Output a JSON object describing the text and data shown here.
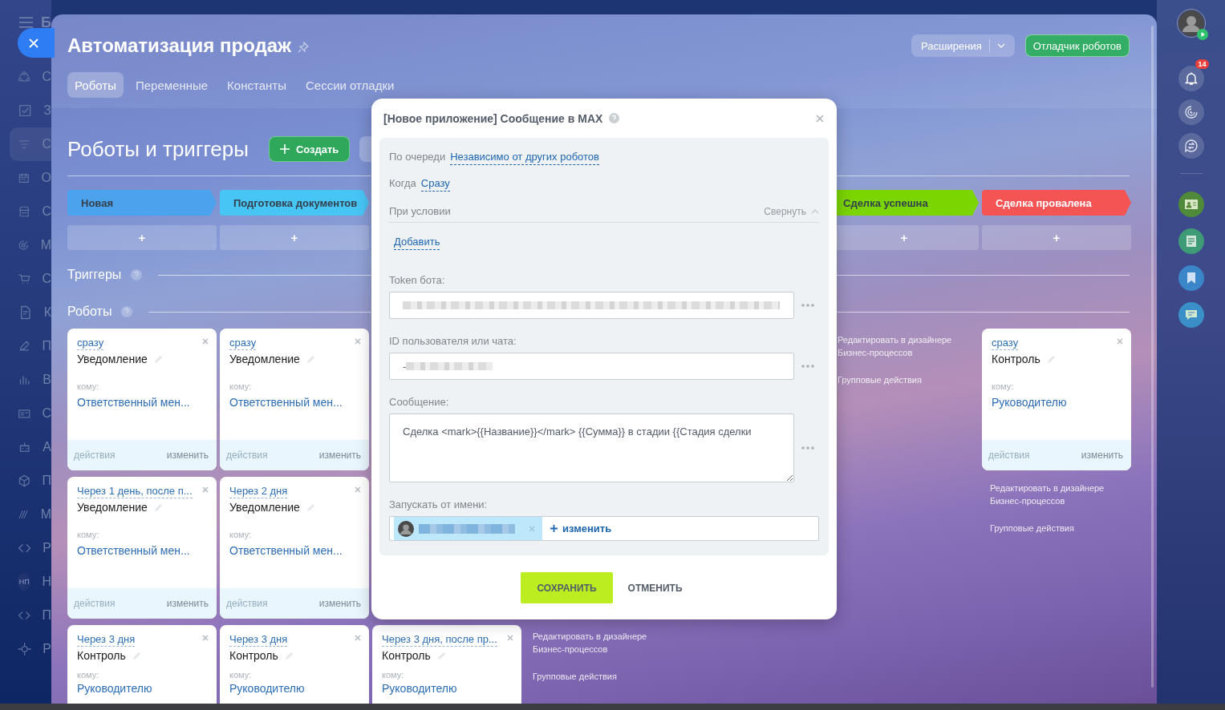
{
  "sidebar": {
    "header_letter": "Б",
    "items": [
      {
        "kind": "link",
        "label": "С",
        "selected": false
      },
      {
        "kind": "link",
        "label": "З",
        "selected": false
      },
      {
        "kind": "link",
        "label": "С",
        "selected": true
      },
      {
        "kind": "link",
        "label": "О",
        "selected": false
      },
      {
        "kind": "link",
        "label": "С",
        "selected": false
      },
      {
        "kind": "link",
        "label": "М",
        "selected": false
      },
      {
        "kind": "link",
        "label": "С",
        "selected": false
      },
      {
        "kind": "link",
        "label": "К",
        "selected": false
      },
      {
        "kind": "link",
        "label": "П",
        "selected": false
      },
      {
        "kind": "link",
        "label": "В",
        "selected": false
      },
      {
        "kind": "link",
        "label": "С",
        "selected": false
      },
      {
        "kind": "link",
        "label": "А",
        "selected": false
      },
      {
        "kind": "link",
        "label": "П",
        "selected": false
      },
      {
        "kind": "link",
        "label": "М",
        "selected": false
      },
      {
        "kind": "link",
        "label": "Р",
        "selected": false
      },
      {
        "kind": "avatar",
        "initials": "НП",
        "label": "Н",
        "selected": false
      },
      {
        "kind": "link",
        "label": "П",
        "selected": false
      },
      {
        "kind": "link",
        "label": "Р",
        "selected": false
      }
    ]
  },
  "panel": {
    "title": "Автоматизация продаж",
    "tabs": [
      {
        "label": "Роботы",
        "selected": true
      },
      {
        "label": "Переменные",
        "selected": false
      },
      {
        "label": "Константы",
        "selected": false
      },
      {
        "label": "Сессии отладки",
        "selected": false
      }
    ],
    "extensions_button": "Расширения",
    "debugger_button": "Отладчик роботов"
  },
  "section": {
    "title": "Роботы и триггеры",
    "create_button": "Создать",
    "triggers_heading": "Триггеры",
    "robots_heading": "Роботы"
  },
  "columns": [
    {
      "stage": {
        "label": "Новая",
        "color": "#4ba3ee"
      },
      "add_label": "+",
      "robots": [
        {
          "delay": "сразу",
          "title": "Уведомление",
          "to_label": "кому:",
          "recipient": "Ответственный мен...",
          "actions": "действия",
          "edit": "изменить"
        },
        {
          "delay": "Через 1 день, после п...",
          "title": "Уведомление",
          "to_label": "кому:",
          "recipient": "Ответственный мен...",
          "actions": "действия",
          "edit": "изменить"
        },
        {
          "delay": "Через 3 дня",
          "title": "Контроль",
          "to_label": "кому:",
          "recipient": "Руководителю"
        }
      ]
    },
    {
      "stage": {
        "label": "Подготовка документов",
        "color": "#47c5f5"
      },
      "add_label": "+",
      "robots": [
        {
          "delay": "сразу",
          "title": "Уведомление",
          "to_label": "кому:",
          "recipient": "Ответственный мен...",
          "actions": "действия",
          "edit": "изменить"
        },
        {
          "delay": "Через 2 дня",
          "title": "Уведомление",
          "to_label": "кому:",
          "recipient": "Ответственный мен...",
          "actions": "действия",
          "edit": "изменить"
        },
        {
          "delay": "Через 3 дня",
          "title": "Контроль",
          "to_label": "кому:",
          "recipient": "Руководителю"
        }
      ]
    },
    {
      "robots": [
        {
          "delay": "Через 3 дня, после пр...",
          "title": "Контроль",
          "to_label": "кому:",
          "recipient": "Руководителю"
        }
      ]
    },
    {
      "links": [
        "Редактировать в дизайнере Бизнес-процессов",
        "Групповые действия"
      ]
    },
    {},
    {
      "stage": {
        "label": "Сделка успешна",
        "color": "#7bd500"
      },
      "add_label": "+",
      "links": [
        "Редактировать в дизайнере Бизнес-процессов",
        "Групповые действия"
      ]
    },
    {
      "stage": {
        "label": "Сделка провалена",
        "color": "#f55454"
      },
      "add_label": "+",
      "robots": [
        {
          "delay": "сразу",
          "title": "Контроль",
          "to_label": "кому:",
          "recipient": "Руководителю",
          "actions": "действия",
          "edit": "изменить"
        }
      ],
      "links": [
        "Редактировать в дизайнере Бизнес-процессов",
        "Групповые действия"
      ]
    }
  ],
  "modal": {
    "title": "[Новое приложение] Сообщение в MAX",
    "order_label": "По очереди",
    "order_value": "Независимо от других роботов",
    "when_label": "Когда",
    "when_value": "Сразу",
    "condition_label": "При условии",
    "collapse_label": "Свернуть",
    "add_condition": "Добавить",
    "token_label": "Token бота:",
    "id_label": "ID пользователя или чата:",
    "id_value_prefix": "-",
    "message_label": "Сообщение:",
    "message_value": "Сделка <mark>{{Название}}</mark> {{Сумма}} в стадии {{Стадия сделки",
    "run_as_label": "Запускать от имени:",
    "change_user": "изменить",
    "save_button": "СОХРАНИТЬ",
    "cancel_button": "ОТМЕНИТЬ"
  },
  "right_bar": {
    "notifications_count": "14"
  }
}
